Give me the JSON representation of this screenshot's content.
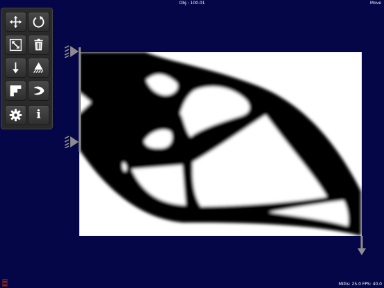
{
  "header": {
    "objective": "Obj.: 100.01",
    "mode": "Move"
  },
  "footer": {
    "stats": "Millis: 25.0 FPS: 40.0"
  },
  "colors": {
    "background": "#040648",
    "toolbar": "#2a2a2a",
    "design_domain": "#ffffff",
    "material": "#000000"
  },
  "toolbar": {
    "tools": [
      {
        "name": "move",
        "icon": "move-arrows-icon"
      },
      {
        "name": "reset",
        "icon": "circular-arrow-icon"
      },
      {
        "name": "resize",
        "icon": "resize-diagonal-icon"
      },
      {
        "name": "delete",
        "icon": "trash-icon"
      },
      {
        "name": "load",
        "icon": "down-arrow-icon"
      },
      {
        "name": "support",
        "icon": "support-icon"
      },
      {
        "name": "passive",
        "icon": "stairs-icon"
      },
      {
        "name": "optimize",
        "icon": "spiral-icon"
      },
      {
        "name": "settings",
        "icon": "gear-icon"
      },
      {
        "name": "info",
        "icon": "info-icon",
        "glyph": "i"
      }
    ]
  },
  "supports": [
    "pin-support-upper",
    "pin-support-lower"
  ],
  "loads": [
    "point-load-downward"
  ]
}
